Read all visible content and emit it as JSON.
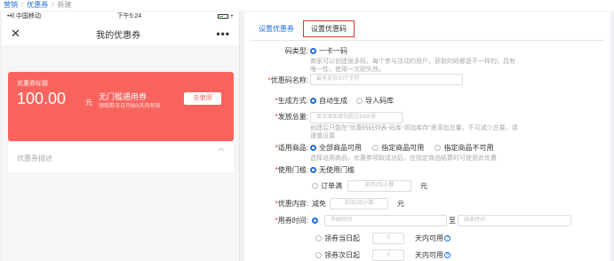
{
  "breadcrumb": {
    "items": [
      "营销",
      "优惠券",
      "新建"
    ]
  },
  "phone": {
    "status": {
      "carrier": "••ll 中国移动",
      "time": "下午5:24",
      "right": "◉ ▭ +"
    },
    "navbar": {
      "close": "✕",
      "title": "我的优惠券",
      "more": "•••"
    },
    "coupon": {
      "tag": "优惠券标题",
      "amount": "100.00",
      "unit": "元",
      "title": "无门槛通用券",
      "desc": "领取券次日开始3天内有效",
      "use_button": "去使用"
    },
    "desc_row": {
      "label": "优惠券描述",
      "chevron": "︿"
    }
  },
  "tabs": {
    "items": [
      "设置优惠券",
      "设置优惠码"
    ],
    "active": 1
  },
  "form": {
    "code_type": {
      "label": "码类型:",
      "option": "一卡一码",
      "hint_line1": "商家可以创建很多码，每个参与活动的用户，获取的码都是不一样的，具有",
      "hint_line2": "唯一性，使用一次即失效。"
    },
    "name": {
      "label": "优惠码名称:",
      "placeholder": "最多支持30个字符"
    },
    "gen_method": {
      "label": "生成方式:",
      "options": [
        "自动生成",
        "导入码库"
      ]
    },
    "issue_total": {
      "label": "发放总量:",
      "placeholder": "单次添加请勿超过1000张",
      "hint_line1": "创建后只能在\"优惠码码列表-码库-添加库存\"里添加总量，不可减少总量，请",
      "hint_line2": "谨慎设置"
    },
    "applicable": {
      "label": "适用商品:",
      "options": [
        "全部商品可用",
        "指定商品可用",
        "指定商品不可用"
      ],
      "hint": "选择适用商品，优惠券领取成功后，在指定商品结算时可使用此优惠"
    },
    "threshold": {
      "label": "使用门槛:",
      "option_none": "无使用门槛",
      "option_full": "订单满",
      "placeholder": "支持2位小数",
      "unit": "元"
    },
    "content": {
      "label": "优惠内容:",
      "prefix": "减免",
      "placeholder": "支持2位小数",
      "unit": "元"
    },
    "time": {
      "label": "用券时间:",
      "start_placeholder": "开始时间",
      "to": "至",
      "end_placeholder": "结束时间",
      "same_day": {
        "prefix": "领券当日起",
        "value": "0",
        "suffix": "天内可用"
      },
      "next_day": {
        "prefix": "领券次日起",
        "value": "0",
        "suffix": "天内可用"
      },
      "help": "?"
    }
  },
  "colors": {
    "primary": "#1e6fd9",
    "coupon": "#f8645d",
    "tab_border": "#d9362b",
    "required": "#e33"
  }
}
